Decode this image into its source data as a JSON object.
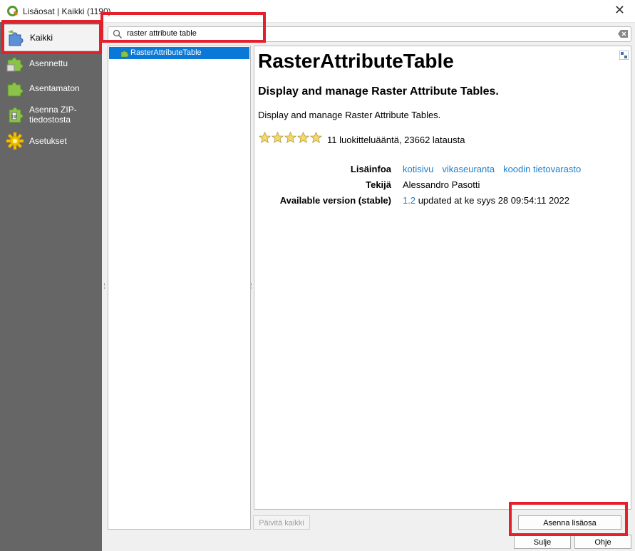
{
  "window": {
    "title": "Lisäosat | Kaikki (1190)",
    "close_glyph": "✕"
  },
  "sidebar": {
    "items": [
      {
        "label": "Kaikki",
        "icon": "puzzle-blue-icon"
      },
      {
        "label": "Asennettu",
        "icon": "puzzle-green-icon"
      },
      {
        "label": "Asentamaton",
        "icon": "puzzle-green-icon"
      },
      {
        "label": "Asenna ZIP-\ntiedostosta",
        "icon": "zip-icon"
      },
      {
        "label": "Asetukset",
        "icon": "gear-icon"
      }
    ]
  },
  "search": {
    "value": "raster attribute table"
  },
  "plugin_list": {
    "items": [
      {
        "label": "RasterAttributeTable"
      }
    ]
  },
  "detail": {
    "title": "RasterAttributeTable",
    "subtitle": "Display and manage Raster Attribute Tables.",
    "description": "Display and manage Raster Attribute Tables.",
    "rating_stars": 5,
    "rating_text": "11 luokitteluääntä, 23662 latausta",
    "more_info_label": "Lisäinfoa",
    "links": [
      "kotisivu",
      "vikaseuranta",
      "koodin tietovarasto"
    ],
    "author_label": "Tekijä",
    "author": "Alessandro Pasotti",
    "version_label": "Available version (stable)",
    "version": "1.2",
    "version_suffix": " updated at ke syys 28 09:54:11 2022"
  },
  "buttons": {
    "upgrade_all": "Päivitä kaikki",
    "install": "Asenna lisäosa",
    "close": "Sulje",
    "help": "Ohje"
  },
  "colors": {
    "highlight": "#e3202c",
    "selection": "#0a78d7",
    "link": "#1a7ed0",
    "sidebar": "#666666"
  }
}
